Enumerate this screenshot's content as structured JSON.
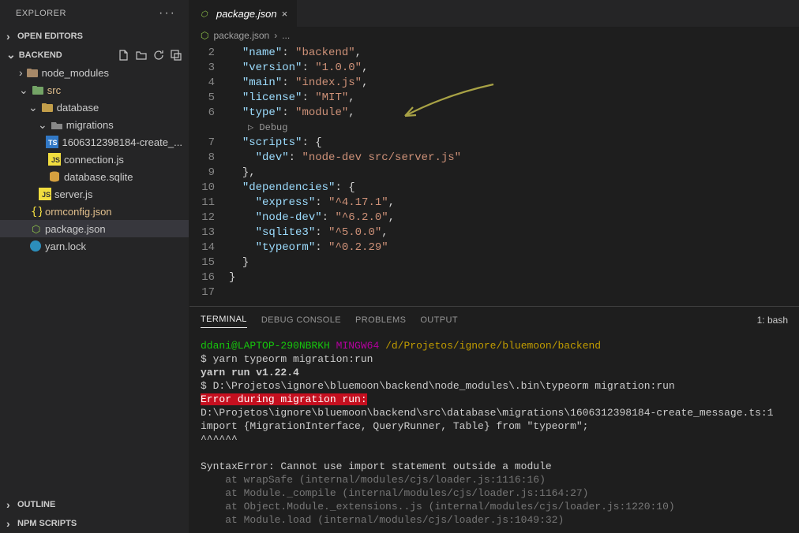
{
  "sidebar": {
    "title": "EXPLORER",
    "sections": {
      "open_editors": "OPEN EDITORS",
      "folder": "BACKEND",
      "outline": "OUTLINE",
      "npm": "NPM SCRIPTS"
    },
    "tree": [
      {
        "name": "node_modules",
        "indent": 1,
        "chev": ">",
        "icon": "folder-pkg"
      },
      {
        "name": "src",
        "indent": 1,
        "chev": "v",
        "icon": "folder-src",
        "mod": true
      },
      {
        "name": "database",
        "indent": 2,
        "chev": "v",
        "icon": "folder-db"
      },
      {
        "name": "migrations",
        "indent": 3,
        "chev": "v",
        "icon": "folder-open-grey"
      },
      {
        "name": "1606312398184-create_...",
        "indent": 4,
        "icon": "ts"
      },
      {
        "name": "connection.js",
        "indent": 3,
        "icon": "js"
      },
      {
        "name": "database.sqlite",
        "indent": 3,
        "icon": "db"
      },
      {
        "name": "server.js",
        "indent": 2,
        "icon": "js"
      },
      {
        "name": "ormconfig.json",
        "indent": 1,
        "icon": "json",
        "mod": true
      },
      {
        "name": "package.json",
        "indent": 1,
        "icon": "npm",
        "active": true
      },
      {
        "name": "yarn.lock",
        "indent": 1,
        "icon": "yarn"
      }
    ]
  },
  "tab": {
    "title": "package.json"
  },
  "breadcrumb": {
    "file": "package.json",
    "rest": "..."
  },
  "code": {
    "codelens": "Debug",
    "lines": [
      {
        "n": 2,
        "pad": 2,
        "parts": [
          [
            "key",
            "\"name\""
          ],
          [
            "pun",
            ": "
          ],
          [
            "str",
            "\"backend\""
          ],
          [
            "pun",
            ","
          ]
        ]
      },
      {
        "n": 3,
        "pad": 2,
        "parts": [
          [
            "key",
            "\"version\""
          ],
          [
            "pun",
            ": "
          ],
          [
            "str",
            "\"1.0.0\""
          ],
          [
            "pun",
            ","
          ]
        ]
      },
      {
        "n": 4,
        "pad": 2,
        "parts": [
          [
            "key",
            "\"main\""
          ],
          [
            "pun",
            ": "
          ],
          [
            "str",
            "\"index.js\""
          ],
          [
            "pun",
            ","
          ]
        ]
      },
      {
        "n": 5,
        "pad": 2,
        "parts": [
          [
            "key",
            "\"license\""
          ],
          [
            "pun",
            ": "
          ],
          [
            "str",
            "\"MIT\""
          ],
          [
            "pun",
            ","
          ]
        ]
      },
      {
        "n": 6,
        "pad": 2,
        "parts": [
          [
            "key",
            "\"type\""
          ],
          [
            "pun",
            ": "
          ],
          [
            "str",
            "\"module\""
          ],
          [
            "pun",
            ","
          ]
        ]
      },
      {
        "codelens": true
      },
      {
        "n": 7,
        "pad": 2,
        "parts": [
          [
            "key",
            "\"scripts\""
          ],
          [
            "pun",
            ": {"
          ]
        ]
      },
      {
        "n": 8,
        "pad": 4,
        "parts": [
          [
            "key",
            "\"dev\""
          ],
          [
            "pun",
            ": "
          ],
          [
            "str",
            "\"node-dev src/server.js\""
          ]
        ]
      },
      {
        "n": 9,
        "pad": 2,
        "parts": [
          [
            "pun",
            "},"
          ]
        ]
      },
      {
        "n": 10,
        "pad": 2,
        "parts": [
          [
            "key",
            "\"dependencies\""
          ],
          [
            "pun",
            ": {"
          ]
        ]
      },
      {
        "n": 11,
        "pad": 4,
        "parts": [
          [
            "key",
            "\"express\""
          ],
          [
            "pun",
            ": "
          ],
          [
            "str",
            "\"^4.17.1\""
          ],
          [
            "pun",
            ","
          ]
        ]
      },
      {
        "n": 12,
        "pad": 4,
        "parts": [
          [
            "key",
            "\"node-dev\""
          ],
          [
            "pun",
            ": "
          ],
          [
            "str",
            "\"^6.2.0\""
          ],
          [
            "pun",
            ","
          ]
        ]
      },
      {
        "n": 13,
        "pad": 4,
        "parts": [
          [
            "key",
            "\"sqlite3\""
          ],
          [
            "pun",
            ": "
          ],
          [
            "str",
            "\"^5.0.0\""
          ],
          [
            "pun",
            ","
          ]
        ]
      },
      {
        "n": 14,
        "pad": 4,
        "parts": [
          [
            "key",
            "\"typeorm\""
          ],
          [
            "pun",
            ": "
          ],
          [
            "str",
            "\"^0.2.29\""
          ]
        ]
      },
      {
        "n": 15,
        "pad": 2,
        "parts": [
          [
            "pun",
            "}"
          ]
        ]
      },
      {
        "n": 16,
        "pad": 0,
        "parts": [
          [
            "pun",
            "}"
          ]
        ]
      },
      {
        "n": 17,
        "pad": 0,
        "parts": []
      }
    ]
  },
  "panel": {
    "tabs": [
      "TERMINAL",
      "DEBUG CONSOLE",
      "PROBLEMS",
      "OUTPUT"
    ],
    "shell": "1: bash",
    "term": {
      "user": "ddani@LAPTOP-290NBRKH",
      "sys": "MINGW64",
      "path": "/d/Projetos/ignore/bluemoon/backend",
      "cmd1": "$ yarn typeorm migration:run",
      "run": "yarn run v1.22.4",
      "cmd2": "$ D:\\Projetos\\ignore\\bluemoon\\backend\\node_modules\\.bin\\typeorm migration:run",
      "err": "Error during migration run:",
      "file": "D:\\Projetos\\ignore\\bluemoon\\backend\\src\\database\\migrations\\1606312398184-create_message.ts:1",
      "imp": "import {MigrationInterface, QueryRunner, Table} from \"typeorm\";",
      "caret": "^^^^^^",
      "syn": "SyntaxError: Cannot use import statement outside a module",
      "stack": [
        "    at wrapSafe (internal/modules/cjs/loader.js:1116:16)",
        "    at Module._compile (internal/modules/cjs/loader.js:1164:27)",
        "    at Object.Module._extensions..js (internal/modules/cjs/loader.js:1220:10)",
        "    at Module.load (internal/modules/cjs/loader.js:1049:32)"
      ]
    }
  }
}
